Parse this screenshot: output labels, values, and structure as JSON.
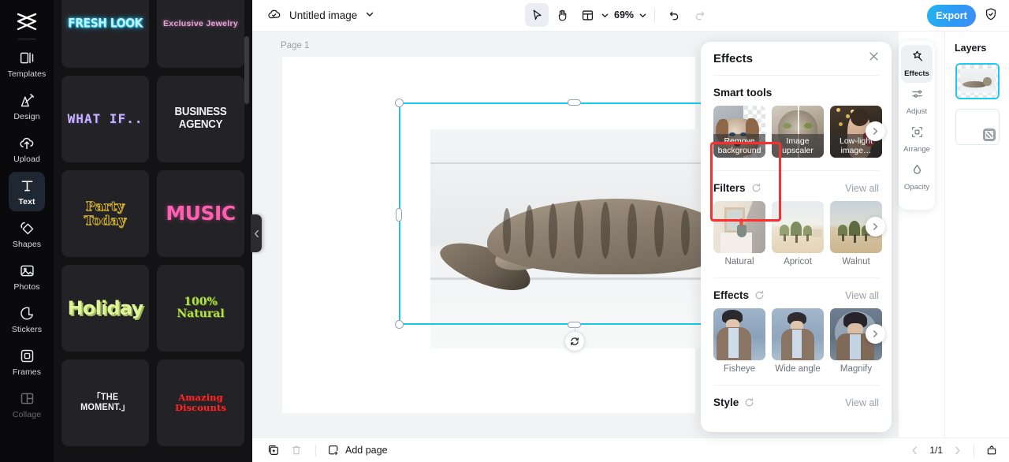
{
  "app": {
    "brand_icon": "capcut-logo-icon"
  },
  "left_rail": {
    "items": [
      {
        "label": "Templates",
        "icon": "templates-icon",
        "active": false
      },
      {
        "label": "Design",
        "icon": "design-icon",
        "active": false
      },
      {
        "label": "Upload",
        "icon": "upload-cloud-icon",
        "active": false
      },
      {
        "label": "Text",
        "icon": "text-icon",
        "active": true
      },
      {
        "label": "Shapes",
        "icon": "shapes-icon",
        "active": false
      },
      {
        "label": "Photos",
        "icon": "photos-icon",
        "active": false
      },
      {
        "label": "Stickers",
        "icon": "stickers-icon",
        "active": false
      },
      {
        "label": "Frames",
        "icon": "frames-icon",
        "active": false
      },
      {
        "label": "Collage",
        "icon": "collage-icon",
        "active": false
      }
    ]
  },
  "template_panel": {
    "cards": [
      {
        "text": "FRESH LOOK",
        "style": "t-fresh"
      },
      {
        "text": "Exclusive Jewelry",
        "style": "t-jewel"
      },
      {
        "text": "WHAT IF..",
        "style": "t-whatif"
      },
      {
        "text": "BUSINESS AGENCY",
        "style": "t-biz"
      },
      {
        "text": "Party Today",
        "style": "t-party"
      },
      {
        "text": "MUSIC",
        "style": "t-music"
      },
      {
        "text": "Holiday",
        "style": "t-holiday"
      },
      {
        "text": "100% Natural",
        "style": "t-natural"
      },
      {
        "text": "「THE MOMENT.」",
        "style": "t-moment"
      },
      {
        "text": "Amazing Discounts",
        "style": "t-discount"
      }
    ]
  },
  "topbar": {
    "cloud_icon": "cloud-saved-icon",
    "doc_title": "Untitled image",
    "title_caret": "chevron-down-icon",
    "select_tool_icon": "cursor-select-icon",
    "hand_tool_icon": "hand-pan-icon",
    "layout_tool_icon": "layout-grid-icon",
    "layout_caret": "chevron-down-icon",
    "zoom_value": "69%",
    "zoom_caret": "chevron-down-icon",
    "undo_icon": "undo-icon",
    "redo_icon": "redo-icon",
    "export_label": "Export",
    "shield_icon": "shield-check-icon"
  },
  "canvas": {
    "page_label": "Page 1",
    "selection_color": "#19c7ed",
    "float_toolbar": [
      {
        "icon": "crop-icon",
        "name": "crop-button"
      },
      {
        "icon": "cutout-icon",
        "name": "cutout-button"
      },
      {
        "icon": "duplicate-icon",
        "name": "duplicate-button"
      },
      {
        "icon": "more-icon",
        "name": "more-button"
      }
    ],
    "rotate_icon": "rotate-icon"
  },
  "effects_panel": {
    "title": "Effects",
    "close_icon": "close-icon",
    "sections": [
      {
        "title": "Smart tools",
        "has_reset": false,
        "view_all": null,
        "items": [
          {
            "caption": "Remove background",
            "overlay": true,
            "highlighted": true
          },
          {
            "caption": "Image upscaler",
            "overlay": true,
            "highlighted": false
          },
          {
            "caption": "Low-light image…",
            "overlay": true,
            "highlighted": false
          }
        ]
      },
      {
        "title": "Filters",
        "has_reset": true,
        "view_all": "View all",
        "items": [
          {
            "caption": "Natural",
            "overlay": false,
            "highlighted": false
          },
          {
            "caption": "Apricot",
            "overlay": false,
            "highlighted": false
          },
          {
            "caption": "Walnut",
            "overlay": false,
            "highlighted": false
          }
        ]
      },
      {
        "title": "Effects",
        "has_reset": true,
        "view_all": "View all",
        "items": [
          {
            "caption": "Fisheye",
            "overlay": false,
            "highlighted": false
          },
          {
            "caption": "Wide angle",
            "overlay": false,
            "highlighted": false
          },
          {
            "caption": "Magnify",
            "overlay": false,
            "highlighted": false
          }
        ]
      },
      {
        "title": "Style",
        "has_reset": true,
        "view_all": "View all",
        "items": []
      }
    ],
    "highlight_color": "#ff2d2d",
    "next_icon": "chevron-right-icon",
    "reset_icon": "reset-icon"
  },
  "right_rail": {
    "items": [
      {
        "label": "Effects",
        "icon": "magic-wand-icon",
        "active": true
      },
      {
        "label": "Adjust",
        "icon": "sliders-icon",
        "active": false
      },
      {
        "label": "Arrange",
        "icon": "arrange-icon",
        "active": false
      },
      {
        "label": "Opacity",
        "icon": "opacity-drop-icon",
        "active": false
      }
    ]
  },
  "layers_panel": {
    "title": "Layers",
    "layers": [
      {
        "name": "cat-image-layer",
        "selected": true,
        "type": "image"
      },
      {
        "name": "blank-layer",
        "selected": false,
        "type": "blank"
      }
    ]
  },
  "bottombar": {
    "duplicate_page_icon": "duplicate-page-icon",
    "delete_page_icon": "trash-icon",
    "add_page_icon": "add-page-icon",
    "add_page_label": "Add page",
    "prev_icon": "chevron-left-icon",
    "page_count": "1/1",
    "next_icon": "chevron-right-icon",
    "timeline_icon": "timeline-icon"
  }
}
